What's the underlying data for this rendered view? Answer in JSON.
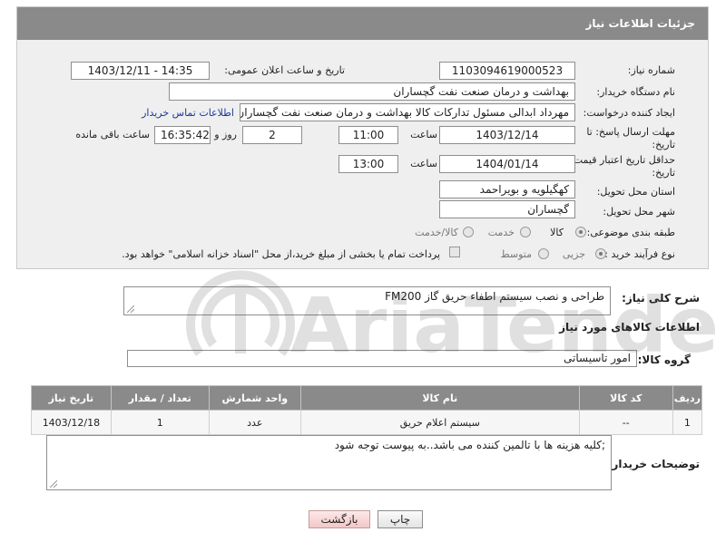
{
  "panel": {
    "title": "جزئیات اطلاعات نیاز"
  },
  "fields": {
    "need_number": {
      "label": "شماره نیاز:",
      "value": "1103094619000523"
    },
    "announce_datetime": {
      "label": "تاریخ و ساعت اعلان عمومی:",
      "value": "1403/12/11 - 14:35"
    },
    "buyer_org": {
      "label": "نام دستگاه خریدار:",
      "value": "بهداشت و درمان صنعت نفت گچساران"
    },
    "requester": {
      "label": "ایجاد کننده درخواست:",
      "value": "مهرداد ابدالی مسئول تدارکات کالا  بهداشت و درمان صنعت نفت گچساران",
      "contact_link": "اطلاعات تماس خریدار"
    },
    "reply_deadline": {
      "label_line1": "مهلت ارسال پاسخ: تا",
      "label_line2": "تاریخ:",
      "date": "1403/12/14",
      "time_label": "ساعت",
      "time": "11:00",
      "days": "2",
      "days_label": "روز و",
      "remaining": "16:35:42",
      "remaining_label": "ساعت باقی مانده"
    },
    "price_validity": {
      "label_line1": "حداقل تاریخ اعتبار قیمت: تا",
      "label_line2": "تاریخ:",
      "date": "1404/01/14",
      "time_label": "ساعت",
      "time": "13:00"
    },
    "delivery_province": {
      "label": "استان محل تحویل:",
      "value": "کهگیلویه و بویراحمد"
    },
    "delivery_city": {
      "label": "شهر محل تحویل:",
      "value": "گچساران"
    },
    "category": {
      "label": "طبقه بندی موضوعی:",
      "options": [
        "کالا",
        "خدمت",
        "کالا/خدمت"
      ],
      "selected": "کالا"
    },
    "purchase_process": {
      "label": "نوع فرآیند خرید :",
      "options": [
        "جزیی",
        "متوسط"
      ],
      "selected": "جزیی",
      "payment_note": "پرداخت تمام یا بخشی از مبلغ خرید،از محل \"اسناد خزانه اسلامی\" خواهد بود."
    }
  },
  "summary": {
    "label": "شرح کلی نیاز:",
    "value": "طراحی و نصب سیستم اطفاء حریق گاز FM200"
  },
  "goods_section": {
    "title": "اطلاعات کالاهای مورد نیاز"
  },
  "goods_group": {
    "label": "گروه کالا:",
    "value": "امور تاسیساتی"
  },
  "table": {
    "headers": [
      "ردیف",
      "کد کالا",
      "نام کالا",
      "واحد شمارش",
      "تعداد / مقدار",
      "تاریخ نیاز"
    ],
    "rows": [
      [
        "1",
        "--",
        "سیستم اعلام حریق",
        "عدد",
        "1",
        "1403/12/18"
      ]
    ]
  },
  "buyer_notes": {
    "label": "توضیحات خریدار:",
    "value": ";کلیه هزینه ها با تالمین کننده می باشد..به پیوست توجه شود"
  },
  "buttons": {
    "print": "چاپ",
    "back": "بازگشت"
  },
  "watermark": {
    "text": "AriaTender.neT"
  }
}
